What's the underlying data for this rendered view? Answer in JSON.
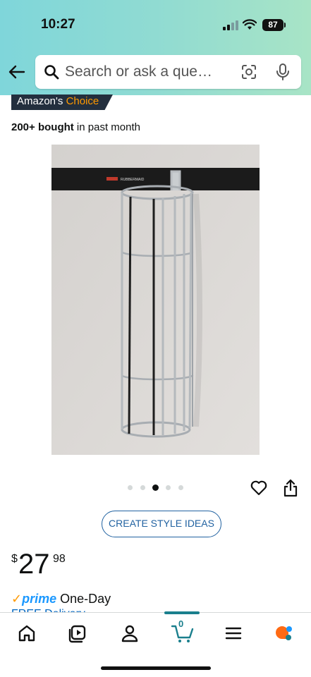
{
  "status_bar": {
    "time": "10:27",
    "battery": "87"
  },
  "search": {
    "placeholder": "Search or ask a que…"
  },
  "badge": {
    "prefix": "Amazon's",
    "highlight": "Choice"
  },
  "bought": {
    "count": "200+ bought",
    "suffix": " in past month"
  },
  "product_image": {
    "brand_mark": "RUBBERMAID"
  },
  "carousel": {
    "total": 5,
    "active_index": 2
  },
  "style_button": {
    "label": "CREATE STYLE IDEAS"
  },
  "price": {
    "currency": "$",
    "whole": "27",
    "fraction": "98"
  },
  "prime": {
    "check": "✓",
    "word": "prime",
    "suffix": " One-Day"
  },
  "delivery": {
    "text": "FREE Delivery"
  },
  "bottom_nav": {
    "cart_count": "0"
  },
  "colors": {
    "header_start": "#7fd6da",
    "header_end": "#a8e4c6",
    "prime": "#1a98ff",
    "link": "#2162a1",
    "cart_accent": "#1a7f8d"
  }
}
